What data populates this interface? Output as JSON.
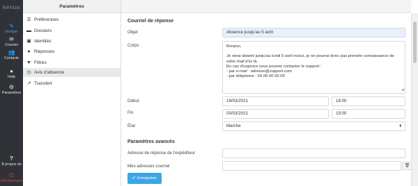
{
  "brand": {
    "logo_text": "kenua"
  },
  "rail": {
    "items": [
      {
        "label": "Rédiger",
        "icon": "compose-icon"
      },
      {
        "label": "Courriel",
        "icon": "mail-icon"
      },
      {
        "label": "Contacts",
        "icon": "contacts-icon"
      },
      {
        "label": "Help",
        "icon": "help-icon"
      },
      {
        "label": "Paramètres",
        "icon": "gear-icon"
      }
    ],
    "about_label": "À propos de",
    "logout_label": "Déconnexion"
  },
  "settings": {
    "title": "Paramètres",
    "items": [
      {
        "label": "Préférences",
        "icon": "preferences-icon"
      },
      {
        "label": "Dossiers",
        "icon": "folder-icon"
      },
      {
        "label": "Identités",
        "icon": "id-card-icon"
      },
      {
        "label": "Réponses",
        "icon": "speech-bubble-icon"
      },
      {
        "label": "Filtres",
        "icon": "filter-icon"
      },
      {
        "label": "Avis d'absence",
        "icon": "clock-icon",
        "active": true
      },
      {
        "label": "Transfert",
        "icon": "forward-icon"
      }
    ]
  },
  "form": {
    "section_title": "Courriel de réponse",
    "subject_label": "Objet",
    "subject_value": "Absence jusqu'au 5 avril",
    "body_label": "Corps",
    "body_lines": [
      "Bonjour,",
      "",
      "Je serai absent jusqu'au lundi 5 avril inclus, je ne pourrai donc pas prendre connaissance de votre mail d'ici là.",
      "En cas d'urgence vous pouvez contacter le support :",
      "- par e-mail : adresse@support.com",
      "- par téléphone : 09 00 00 00 00"
    ],
    "start_label": "Début",
    "start_date": "19/03/2021",
    "start_time": "18:00",
    "end_label": "Fin",
    "end_date": "05/03/2021",
    "end_time": "19:00",
    "state_label": "État",
    "state_value": "Marche",
    "advanced_title": "Paramètres avancés",
    "reply_address_label": "Adresse de réponse de l'expéditeur",
    "reply_address_value": "",
    "my_addresses_label": "Mes adresses courriel",
    "my_addresses_value": "",
    "save_label": "Enregistrer"
  },
  "colors": {
    "rail_bg": "#2f3338",
    "accent": "#3aa6e6",
    "logout": "#e04848",
    "subject_bg": "#e7f0fb"
  }
}
